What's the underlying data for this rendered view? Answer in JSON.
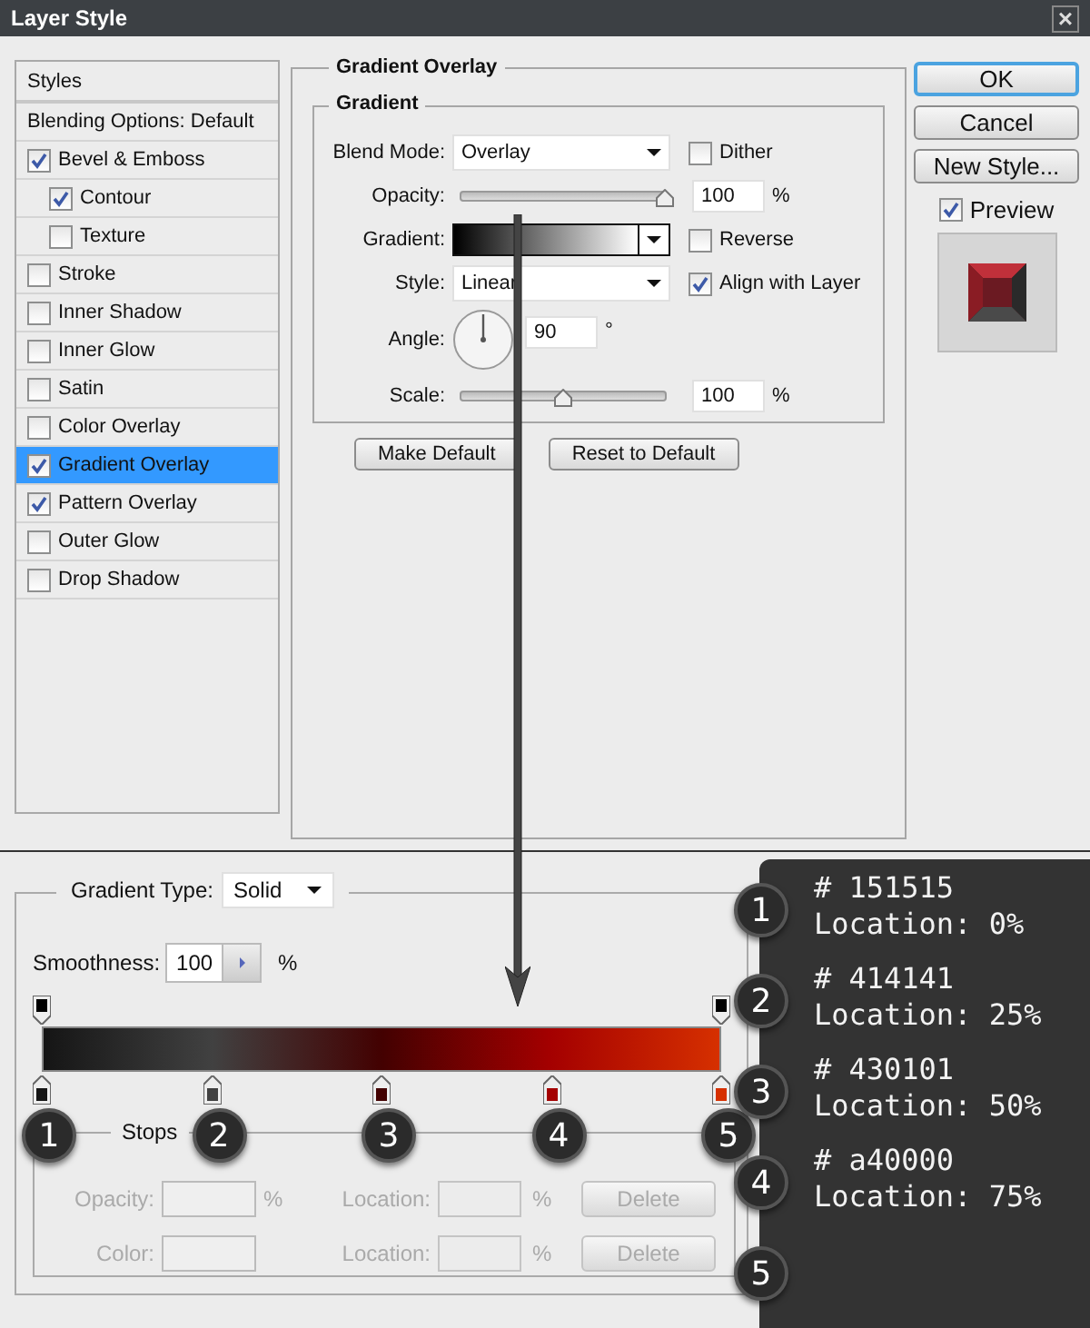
{
  "window": {
    "title": "Layer Style",
    "close": "×"
  },
  "styles_list": {
    "header": "Styles",
    "items": [
      {
        "label": "Blending Options: Default",
        "kind": "plain",
        "selected": false
      },
      {
        "label": "Bevel & Emboss",
        "kind": "check",
        "checked": true,
        "selected": false
      },
      {
        "label": "Contour",
        "kind": "subcheck",
        "checked": true,
        "selected": false
      },
      {
        "label": "Texture",
        "kind": "subcheck",
        "checked": false,
        "selected": false
      },
      {
        "label": "Stroke",
        "kind": "check",
        "checked": false,
        "selected": false
      },
      {
        "label": "Inner Shadow",
        "kind": "check",
        "checked": false,
        "selected": false
      },
      {
        "label": "Inner Glow",
        "kind": "check",
        "checked": false,
        "selected": false
      },
      {
        "label": "Satin",
        "kind": "check",
        "checked": false,
        "selected": false
      },
      {
        "label": "Color Overlay",
        "kind": "check",
        "checked": false,
        "selected": false
      },
      {
        "label": "Gradient Overlay",
        "kind": "check",
        "checked": true,
        "selected": true
      },
      {
        "label": "Pattern Overlay",
        "kind": "check",
        "checked": true,
        "selected": false
      },
      {
        "label": "Outer Glow",
        "kind": "check",
        "checked": false,
        "selected": false
      },
      {
        "label": "Drop Shadow",
        "kind": "check",
        "checked": false,
        "selected": false
      }
    ]
  },
  "gradient_overlay": {
    "title": "Gradient Overlay",
    "group": "Gradient",
    "blend_mode": {
      "label": "Blend Mode:",
      "value": "Overlay"
    },
    "dither": {
      "label": "Dither",
      "checked": false
    },
    "opacity": {
      "label": "Opacity:",
      "level": 1,
      "value": "100",
      "unit": "%"
    },
    "gradient": {
      "label": "Gradient:"
    },
    "reverse": {
      "label": "Reverse",
      "checked": false
    },
    "style": {
      "label": "Style:",
      "value": "Linear"
    },
    "align": {
      "label": "Align with Layer",
      "checked": true
    },
    "angle": {
      "label": "Angle:",
      "value": "90",
      "unit": "°"
    },
    "scale": {
      "label": "Scale:",
      "level": 0.5,
      "value": "100",
      "unit": "%"
    },
    "buttons": [
      "Make Default",
      "Reset to Default"
    ]
  },
  "side_buttons": [
    {
      "label": "OK",
      "kind": "default"
    },
    {
      "label": "Cancel",
      "kind": "normal"
    },
    {
      "label": "New Style...",
      "kind": "normal"
    }
  ],
  "preview": {
    "label": "Preview",
    "checked": true
  },
  "gradient_editor": {
    "type_label": "Gradient Type:",
    "type_value": "Solid",
    "smoothness_label": "Smoothness:",
    "smoothness_value": "100",
    "smoothness_unit": "%",
    "opacity_stops": [
      {
        "color": "#000000"
      },
      {
        "color": "#000000"
      }
    ],
    "color_stops": [
      {
        "color": "#151515",
        "badge": "1"
      },
      {
        "color": "#414141",
        "badge": "2"
      },
      {
        "color": "#430101",
        "badge": "3"
      },
      {
        "color": "#a40000",
        "badge": "4"
      },
      {
        "color": "#d63000",
        "badge": "5"
      }
    ],
    "stops_title": "Stops",
    "rows": [
      {
        "label": "Opacity:",
        "unit": "%",
        "location_label": "Location:",
        "location_unit": "%",
        "button": "Delete",
        "disabled": true
      },
      {
        "label": "Color:",
        "unit": "",
        "location_label": "Location:",
        "location_unit": "%",
        "button": "Delete",
        "disabled": true
      }
    ]
  },
  "info_panel": {
    "items": [
      {
        "badge": "1",
        "hex": "# 151515",
        "location": "Location: 0%"
      },
      {
        "badge": "2",
        "hex": "# 414141",
        "location": "Location: 25%"
      },
      {
        "badge": "3",
        "hex": "# 430101",
        "location": "Location: 50%"
      },
      {
        "badge": "4",
        "hex": "# a40000",
        "location": "Location: 75%"
      },
      {
        "badge": "5"
      }
    ]
  }
}
